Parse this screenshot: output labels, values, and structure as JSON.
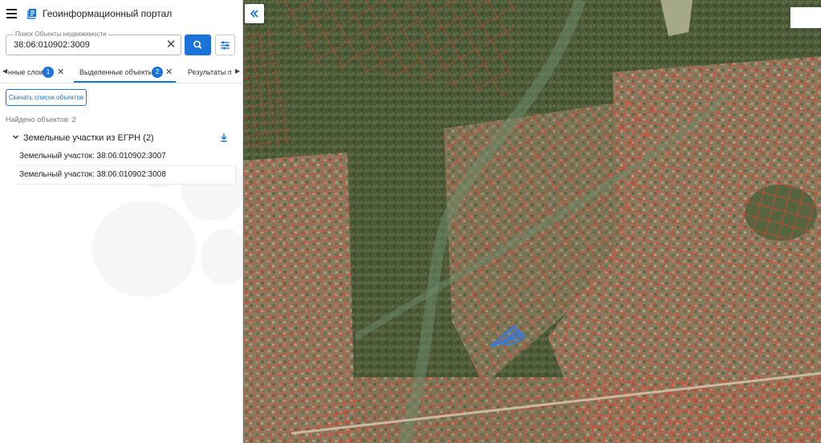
{
  "header": {
    "app_title": "Геоинформационный портал",
    "menu_icon": "hamburger-menu-icon",
    "logo_icon": "portal-logo-icon"
  },
  "search": {
    "label": "Поиск Объекты недвижимости",
    "value": "38:06:010902:3009",
    "clear_icon": "close-icon",
    "search_icon": "search-icon",
    "filter_icon": "filter-sliders-icon"
  },
  "tabs": [
    {
      "label": "нные слои",
      "badge": "1"
    },
    {
      "label": "Выделенные объекты",
      "badge": "2",
      "active": true
    },
    {
      "label": "Результаты п"
    }
  ],
  "actions": {
    "download_list": "Скачать список объектов"
  },
  "results": {
    "found_text": "Найдено объектов: 2",
    "group_title": "Земельные участки из ЕГРН (2)",
    "items": [
      "Земельный участок: 38:06:010902:3007",
      "Земельный участок: 38:06:010902:3008"
    ]
  },
  "map": {
    "collapse_icon": "double-chevron-left-icon",
    "parcel_color": "#e2402f",
    "selection_color": "#2b7de9"
  },
  "colors": {
    "accent": "#1a73d9"
  }
}
